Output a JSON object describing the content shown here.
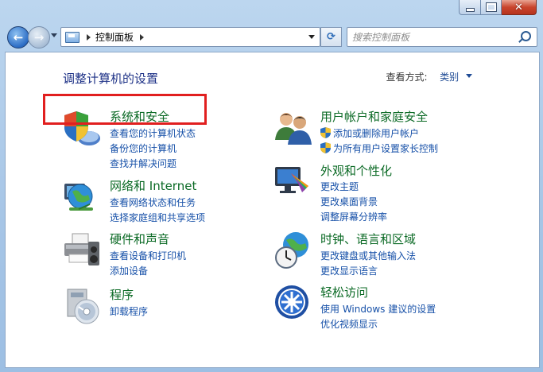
{
  "window": {
    "caption_buttons": {
      "minimize_icon": "minimize-icon",
      "maximize_icon": "maximize-icon",
      "close_glyph": "✕"
    }
  },
  "nav": {
    "back_glyph": "←",
    "forward_glyph": "→",
    "address_crumb": "控制面板",
    "refresh_glyph": "⟳",
    "search_placeholder": "搜索控制面板"
  },
  "content": {
    "page_title": "调整计算机的设置",
    "view_by_label": "查看方式:",
    "view_by_value": "类别",
    "categories": [
      {
        "title": "系统和安全",
        "links": [
          "查看您的计算机状态",
          "备份您的计算机",
          "查找并解决问题"
        ],
        "icon": "shield-icon"
      },
      {
        "title": "网络和 Internet",
        "links": [
          "查看网络状态和任务",
          "选择家庭组和共享选项"
        ],
        "icon": "network-globe-icon"
      },
      {
        "title": "硬件和声音",
        "links": [
          "查看设备和打印机",
          "添加设备"
        ],
        "icon": "printer-icon"
      },
      {
        "title": "程序",
        "links": [
          "卸载程序"
        ],
        "icon": "programs-disc-icon"
      },
      {
        "title": "用户帐户和家庭安全",
        "links": [
          "添加或删除用户帐户",
          "为所有用户设置家长控制"
        ],
        "icon": "users-icon"
      },
      {
        "title": "外观和个性化",
        "links": [
          "更改主题",
          "更改桌面背景",
          "调整屏幕分辨率"
        ],
        "icon": "monitor-palette-icon"
      },
      {
        "title": "时钟、语言和区域",
        "links": [
          "更改键盘或其他输入法",
          "更改显示语言"
        ],
        "icon": "clock-globe-icon"
      },
      {
        "title": "轻松访问",
        "links": [
          "使用 Windows 建议的设置",
          "优化视频显示"
        ],
        "icon": "ease-of-access-icon"
      }
    ]
  },
  "colors": {
    "category_title": "#0b6a25",
    "link": "#1650a8",
    "page_title": "#1e3287",
    "highlight_box": "#e11f1f"
  }
}
